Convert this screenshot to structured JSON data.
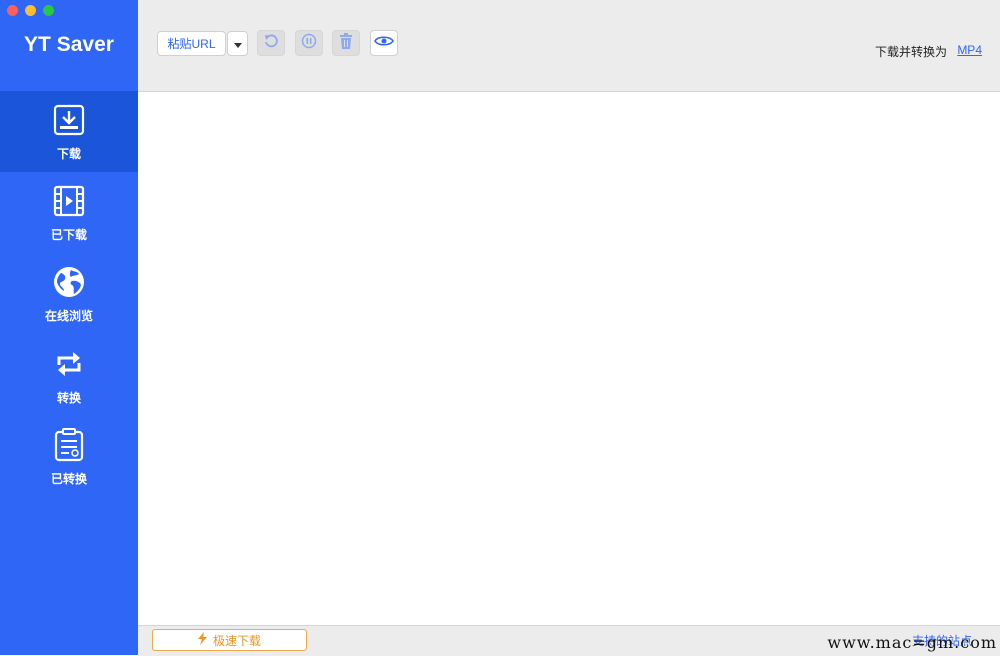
{
  "app": {
    "title": "YT Saver"
  },
  "sidebar": {
    "items": [
      {
        "label": "下载",
        "icon": "download-icon",
        "active": true
      },
      {
        "label": "已下载",
        "icon": "film-icon",
        "active": false
      },
      {
        "label": "在线浏览",
        "icon": "globe-icon",
        "active": false
      },
      {
        "label": "转换",
        "icon": "convert-icon",
        "active": false
      },
      {
        "label": "已转换",
        "icon": "document-icon",
        "active": false
      }
    ]
  },
  "toolbar": {
    "paste_label": "粘贴URL",
    "dropdown_icon": "caret-down-icon",
    "buttons": [
      {
        "icon": "refresh-icon",
        "enabled": false
      },
      {
        "icon": "pause-icon",
        "enabled": false
      },
      {
        "icon": "trash-icon",
        "enabled": false
      },
      {
        "icon": "eye-icon",
        "enabled": true
      }
    ],
    "convert_label": "下载并转换为",
    "convert_format": "MP4"
  },
  "footer": {
    "turbo_label": "极速下载",
    "turbo_icon": "lightning-icon",
    "supported_sites": "支持的站点"
  },
  "watermark": "www.mac=gm.com",
  "colors": {
    "sidebar": "#2f66f5",
    "sidebar_active": "#1b55d9",
    "accent": "#2f66f5",
    "turbo": "#ef9423"
  }
}
